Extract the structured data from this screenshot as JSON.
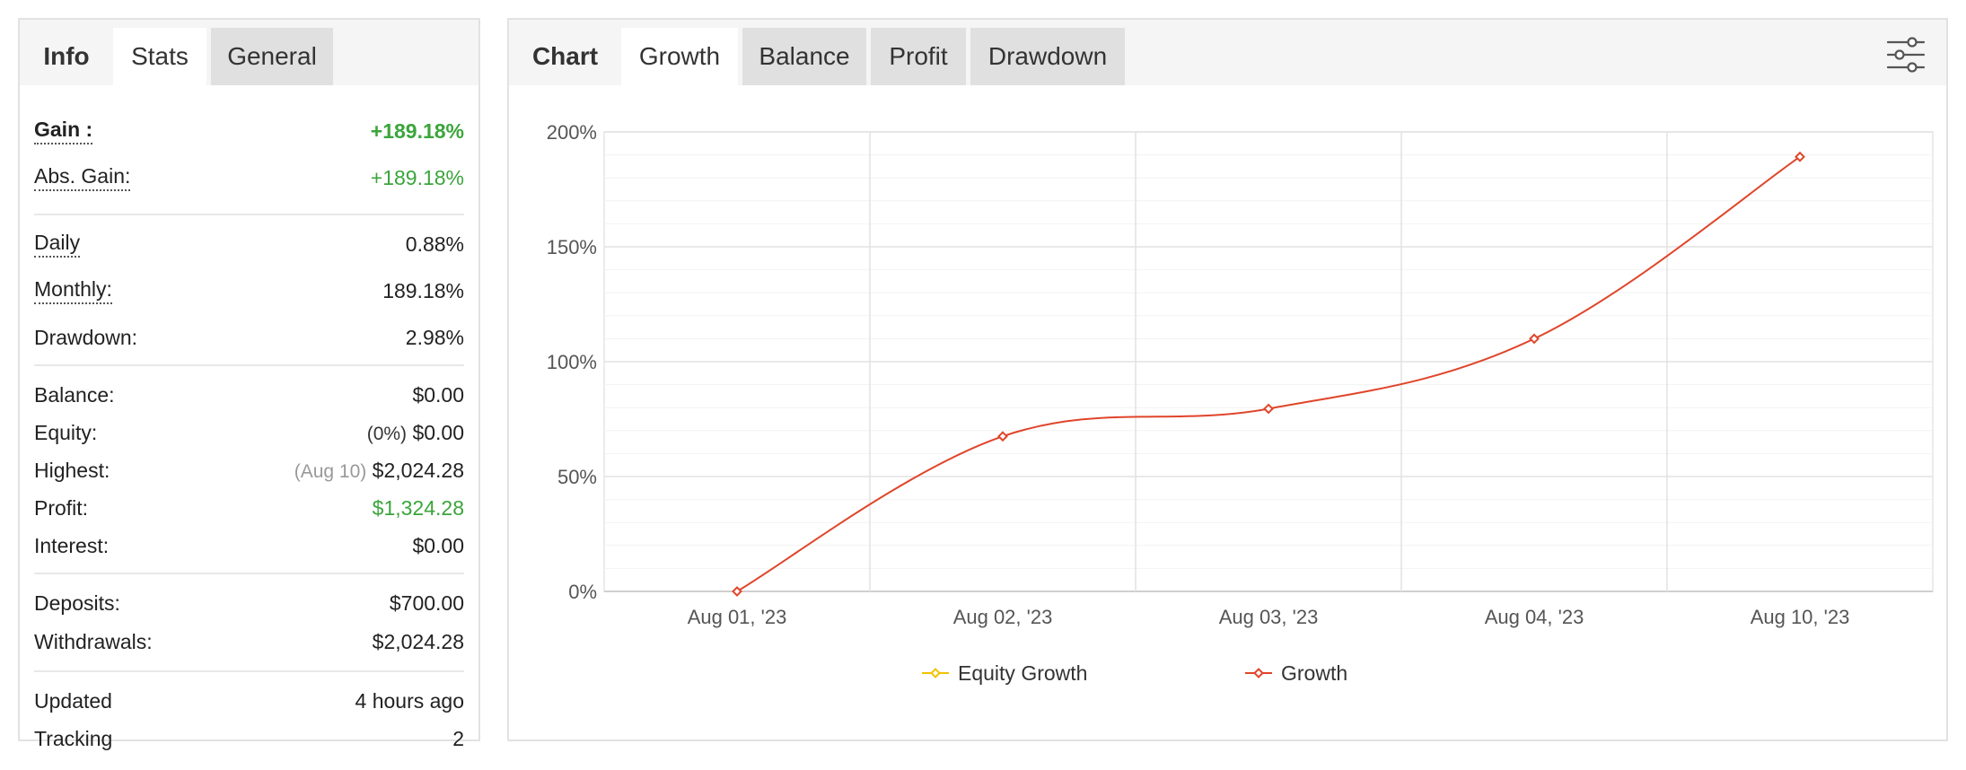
{
  "left_tabs": {
    "head": "Info",
    "stats": "Stats",
    "general": "General"
  },
  "stats": {
    "gain_label": "Gain :",
    "gain_value": "+189.18%",
    "abs_gain_label": "Abs. Gain:",
    "abs_gain_value": "+189.18%",
    "daily_label": "Daily",
    "daily_value": "0.88%",
    "monthly_label": "Monthly:",
    "monthly_value": "189.18%",
    "drawdown_label": "Drawdown:",
    "drawdown_value": "2.98%",
    "balance_label": "Balance:",
    "balance_value": "$0.00",
    "equity_label": "Equity:",
    "equity_prefix": "(0%)",
    "equity_value": "$0.00",
    "highest_label": "Highest:",
    "highest_prefix": "(Aug 10)",
    "highest_value": "$2,024.28",
    "profit_label": "Profit:",
    "profit_value": "$1,324.28",
    "interest_label": "Interest:",
    "interest_value": "$0.00",
    "deposits_label": "Deposits:",
    "deposits_value": "$700.00",
    "withdrawals_label": "Withdrawals:",
    "withdrawals_value": "$2,024.28",
    "updated_label": "Updated",
    "updated_value": "4 hours ago",
    "tracking_label": "Tracking",
    "tracking_value": "2"
  },
  "right_tabs": {
    "head": "Chart",
    "growth": "Growth",
    "balance": "Balance",
    "profit": "Profit",
    "drawdown": "Drawdown"
  },
  "icons": {
    "settings": "sliders-icon"
  },
  "colors": {
    "positive": "#3ba53b",
    "growth_line": "#e0452a",
    "equity_growth_line": "#f2c200"
  },
  "chart_data": {
    "type": "line",
    "title": "",
    "xlabel": "",
    "ylabel": "",
    "categories": [
      "Aug 01, '23",
      "Aug 02, '23",
      "Aug 03, '23",
      "Aug 04, '23",
      "Aug 10, '23"
    ],
    "y_ticks": [
      "0%",
      "50%",
      "100%",
      "150%",
      "200%"
    ],
    "ylim": [
      0,
      200
    ],
    "grid": true,
    "legend_position": "bottom-center",
    "series": [
      {
        "name": "Equity Growth",
        "values": []
      },
      {
        "name": "Growth",
        "values": [
          0,
          67.5,
          79.5,
          110,
          189.18
        ]
      }
    ]
  }
}
